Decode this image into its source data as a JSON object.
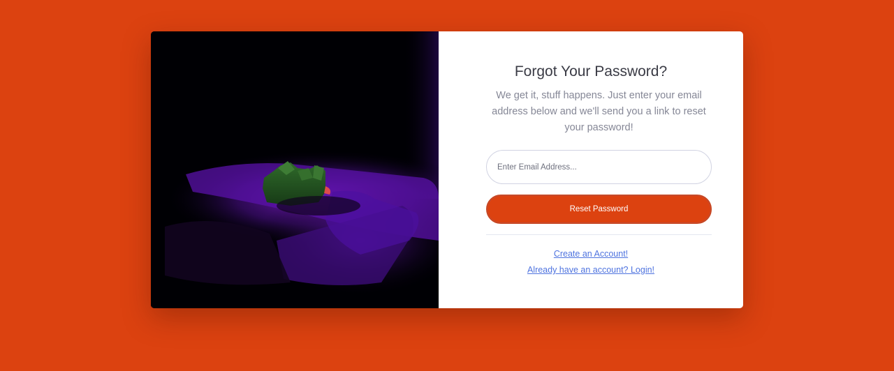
{
  "page": {
    "background_color": "#dc4210"
  },
  "image_panel": {
    "description_icon": "keyboard-key-photo"
  },
  "form": {
    "title": "Forgot Your Password?",
    "subtitle": "We get it, stuff happens. Just enter your email address below and we'll send you a link to reset your password!",
    "email_placeholder": "Enter Email Address...",
    "email_value": "",
    "reset_button_label": "Reset Password",
    "button_color": "#dc4210"
  },
  "links": {
    "create_account": "Create an Account!",
    "login": "Already have an account? Login!",
    "link_color": "#4e73df"
  }
}
